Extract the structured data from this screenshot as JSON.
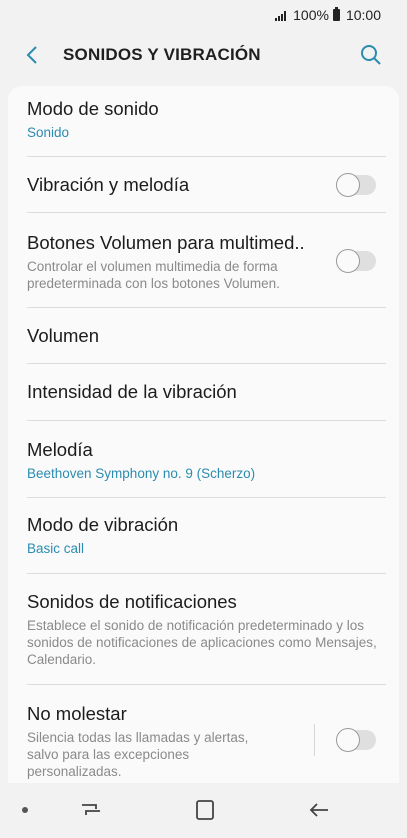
{
  "status_bar": {
    "battery": "100%",
    "time": "10:00"
  },
  "header": {
    "title": "SONIDOS Y VIBRACIÓN"
  },
  "items": [
    {
      "title": "Modo de sonido",
      "subtitle": "Sonido"
    },
    {
      "title": "Vibración y melodía",
      "toggle": false
    },
    {
      "title": "Botones Volumen para multimed..",
      "description": "Controlar el volumen multimedia de forma predeterminada con los botones Volumen.",
      "toggle": false
    },
    {
      "title": "Volumen"
    },
    {
      "title": "Intensidad de la vibración"
    },
    {
      "title": "Melodía",
      "subtitle": "Beethoven Symphony no. 9 (Scherzo)"
    },
    {
      "title": "Modo de vibración",
      "subtitle": "Basic call"
    },
    {
      "title": "Sonidos de notificaciones",
      "description": "Establece el sonido de notificación predeterminado y los sonidos de notificaciones de aplicaciones como Mensajes, Calendario."
    },
    {
      "title": "No molestar",
      "description": "Silencia todas las llamadas y alertas, salvo para las excepciones personalizadas.",
      "toggle": false
    }
  ],
  "colors": {
    "accent": "#2b8cb0",
    "background": "#f2f2f2",
    "card": "#fafafa"
  }
}
